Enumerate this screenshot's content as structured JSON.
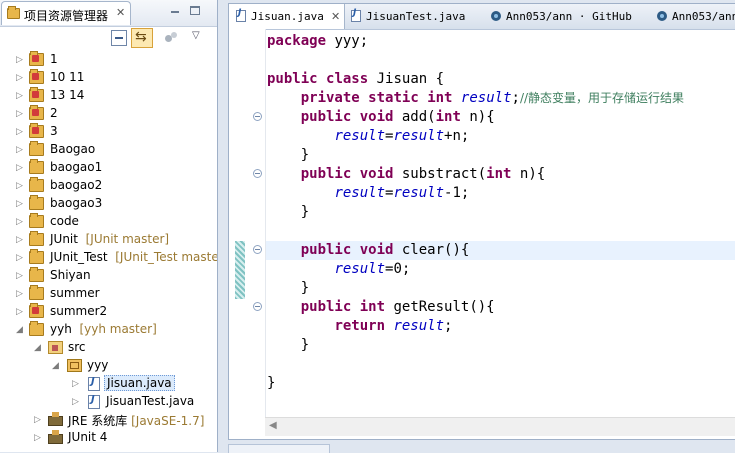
{
  "explorer": {
    "title": "项目资源管理器",
    "close": "✕",
    "menu": "▽",
    "items": [
      {
        "label": "1",
        "deco": ""
      },
      {
        "label": "10 11",
        "deco": ""
      },
      {
        "label": "13 14",
        "deco": ""
      },
      {
        "label": "2",
        "deco": ""
      },
      {
        "label": "3",
        "deco": ""
      },
      {
        "label": "Baogao",
        "deco": ""
      },
      {
        "label": "baogao1",
        "deco": ""
      },
      {
        "label": "baogao2",
        "deco": ""
      },
      {
        "label": "baogao3",
        "deco": ""
      },
      {
        "label": "code",
        "deco": ""
      },
      {
        "label": "JUnit",
        "deco": "[JUnit master]"
      },
      {
        "label": "JUnit_Test",
        "deco": "[JUnit_Test master]"
      },
      {
        "label": "Shiyan",
        "deco": ""
      },
      {
        "label": "summer",
        "deco": ""
      },
      {
        "label": "summer2",
        "deco": ""
      },
      {
        "label": "yyh",
        "deco": "[yyh master]"
      },
      {
        "label": "src",
        "deco": ""
      },
      {
        "label": "yyy",
        "deco": ""
      },
      {
        "label": "Jisuan.java",
        "deco": ""
      },
      {
        "label": "JisuanTest.java",
        "deco": ""
      },
      {
        "label": "JRE 系统库",
        "deco": "[JavaSE-1.7]"
      },
      {
        "label": "JUnit 4",
        "deco": ""
      }
    ]
  },
  "editor": {
    "tabs": [
      {
        "label": "Jisuan.java",
        "close": "✕"
      },
      {
        "label": "JisuanTest.java"
      },
      {
        "label": "Ann053/ann · GitHub"
      },
      {
        "label": "Ann053/ann"
      }
    ],
    "code": {
      "l1_kw": "package",
      "l1_rest": " yyy;",
      "l3_kw1": "public",
      "l3_kw2": "class",
      "l3_rest": " Jisuan {",
      "l4_kw1": "private",
      "l4_kw2": "static",
      "l4_kw3": "int",
      "l4_fld": "result",
      "l4_semi": ";",
      "l4_cmt": "//静态变量，用于存储运行结果",
      "l5_kw1": "public",
      "l5_kw2": "void",
      "l5_mid": " add(",
      "l5_kw3": "int",
      "l5_rest": " n){",
      "l6_fld1": "result",
      "l6_eq": "=",
      "l6_fld2": "result",
      "l6_rest": "+n;",
      "l7": "}",
      "l8_kw1": "public",
      "l8_kw2": "void",
      "l8_mid": " substract(",
      "l8_kw3": "int",
      "l8_rest": " n){",
      "l9_fld1": "result",
      "l9_eq": "=",
      "l9_fld2": "result",
      "l9_rest": "-1;",
      "l10": "}",
      "l12_kw1": "public",
      "l12_kw2": "void",
      "l12_rest": " clear(){",
      "l13_fld": "result",
      "l13_rest": "=0;",
      "l14": "}",
      "l15_kw1": "public",
      "l15_kw2": "int",
      "l15_rest": " getResult(){",
      "l16_kw": "return",
      "l16_fld": "result",
      "l16_rest": ";",
      "l17": "}",
      "l19": "}"
    }
  }
}
